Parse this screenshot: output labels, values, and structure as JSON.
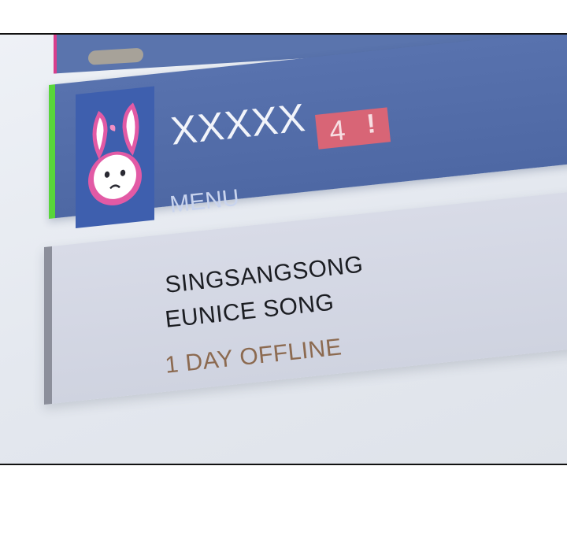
{
  "profile": {
    "username": "XXXXX",
    "badge_count": "4",
    "badge_alert": "!",
    "menu_label": "MENU",
    "avatar_icon": "bunny-avatar-icon",
    "online_indicator_color": "#58d63a",
    "header_color": "#5872ae"
  },
  "details": {
    "battletag": "SINGSANGSONG",
    "real_name": "EUNICE SONG",
    "status": "1 DAY OFFLINE",
    "status_color": "#8c6a50"
  }
}
